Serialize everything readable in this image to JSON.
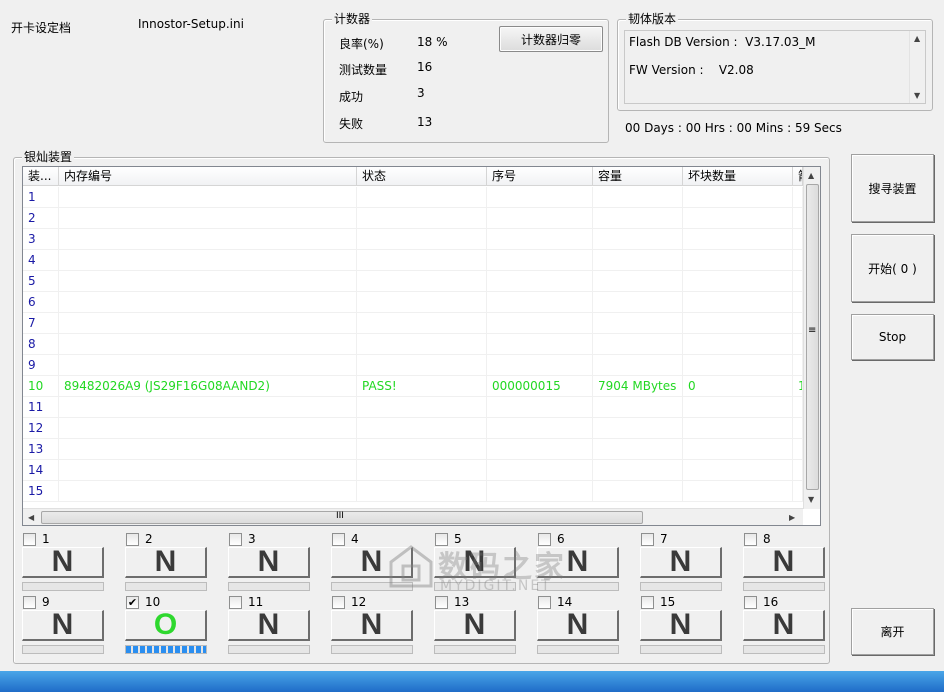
{
  "top": {
    "config_label": "开卡设定档",
    "config_file": "Innostor-Setup.ini"
  },
  "counter": {
    "title": "计数器",
    "reset_label": "计数器归零",
    "rows": [
      {
        "label": "良率(%)",
        "value": "18 %"
      },
      {
        "label": "测试数量",
        "value": "16"
      },
      {
        "label": "成功",
        "value": "3"
      },
      {
        "label": "失败",
        "value": "13"
      }
    ]
  },
  "firmware": {
    "title": "韧体版本",
    "lines": [
      "Flash DB Version :  V3.17.03_M",
      "FW Version :    V2.08"
    ]
  },
  "elapsed": "00 Days : 00 Hrs : 00 Mins : 59 Secs",
  "devices": {
    "title": "银灿装置",
    "columns": [
      "装...",
      "内存编号",
      "状态",
      "序号",
      "容量",
      "坏块数量",
      "箭"
    ],
    "rows": [
      {
        "idx": "1",
        "mem": "",
        "status": "",
        "serial": "",
        "cap": "",
        "bad": "",
        "extra": ""
      },
      {
        "idx": "2",
        "mem": "",
        "status": "",
        "serial": "",
        "cap": "",
        "bad": "",
        "extra": ""
      },
      {
        "idx": "3",
        "mem": "",
        "status": "",
        "serial": "",
        "cap": "",
        "bad": "",
        "extra": ""
      },
      {
        "idx": "4",
        "mem": "",
        "status": "",
        "serial": "",
        "cap": "",
        "bad": "",
        "extra": ""
      },
      {
        "idx": "5",
        "mem": "",
        "status": "",
        "serial": "",
        "cap": "",
        "bad": "",
        "extra": ""
      },
      {
        "idx": "6",
        "mem": "",
        "status": "",
        "serial": "",
        "cap": "",
        "bad": "",
        "extra": ""
      },
      {
        "idx": "7",
        "mem": "",
        "status": "",
        "serial": "",
        "cap": "",
        "bad": "",
        "extra": ""
      },
      {
        "idx": "8",
        "mem": "",
        "status": "",
        "serial": "",
        "cap": "",
        "bad": "",
        "extra": ""
      },
      {
        "idx": "9",
        "mem": "",
        "status": "",
        "serial": "",
        "cap": "",
        "bad": "",
        "extra": ""
      },
      {
        "idx": "10",
        "mem": "89482026A9 (JS29F16G08AAND2)",
        "status": "PASS!",
        "serial": "000000015",
        "cap": "7904 MBytes",
        "bad": "0",
        "extra": "1"
      },
      {
        "idx": "11",
        "mem": "",
        "status": "",
        "serial": "",
        "cap": "",
        "bad": "",
        "extra": ""
      },
      {
        "idx": "12",
        "mem": "",
        "status": "",
        "serial": "",
        "cap": "",
        "bad": "",
        "extra": ""
      },
      {
        "idx": "13",
        "mem": "",
        "status": "",
        "serial": "",
        "cap": "",
        "bad": "",
        "extra": ""
      },
      {
        "idx": "14",
        "mem": "",
        "status": "",
        "serial": "",
        "cap": "",
        "bad": "",
        "extra": ""
      },
      {
        "idx": "15",
        "mem": "",
        "status": "",
        "serial": "",
        "cap": "",
        "bad": "",
        "extra": ""
      }
    ],
    "hscroll_grip": "III",
    "vscroll_grip": "≡"
  },
  "slots": [
    {
      "num": "1",
      "checked": false,
      "state": "N",
      "progress": 0
    },
    {
      "num": "2",
      "checked": false,
      "state": "N",
      "progress": 0
    },
    {
      "num": "3",
      "checked": false,
      "state": "N",
      "progress": 0
    },
    {
      "num": "4",
      "checked": false,
      "state": "N",
      "progress": 0
    },
    {
      "num": "5",
      "checked": false,
      "state": "N",
      "progress": 0
    },
    {
      "num": "6",
      "checked": false,
      "state": "N",
      "progress": 0
    },
    {
      "num": "7",
      "checked": false,
      "state": "N",
      "progress": 0
    },
    {
      "num": "8",
      "checked": false,
      "state": "N",
      "progress": 0
    },
    {
      "num": "9",
      "checked": false,
      "state": "N",
      "progress": 0
    },
    {
      "num": "10",
      "checked": true,
      "state": "O",
      "progress": 1.0
    },
    {
      "num": "11",
      "checked": false,
      "state": "N",
      "progress": 0
    },
    {
      "num": "12",
      "checked": false,
      "state": "N",
      "progress": 0
    },
    {
      "num": "13",
      "checked": false,
      "state": "N",
      "progress": 0
    },
    {
      "num": "14",
      "checked": false,
      "state": "N",
      "progress": 0
    },
    {
      "num": "15",
      "checked": false,
      "state": "N",
      "progress": 0
    },
    {
      "num": "16",
      "checked": false,
      "state": "N",
      "progress": 0
    }
  ],
  "buttons": {
    "search": "搜寻装置",
    "start": "开始( 0 )",
    "stop": "Stop",
    "exit": "离开"
  },
  "watermark": {
    "main": "数码之家",
    "sub": "MYDIGIT.NET"
  },
  "colors": {
    "pass_text": "#22d822",
    "index_text": "#1a1aa6",
    "ok_state": "#2ed82e",
    "progress": "#2a8ef0"
  }
}
